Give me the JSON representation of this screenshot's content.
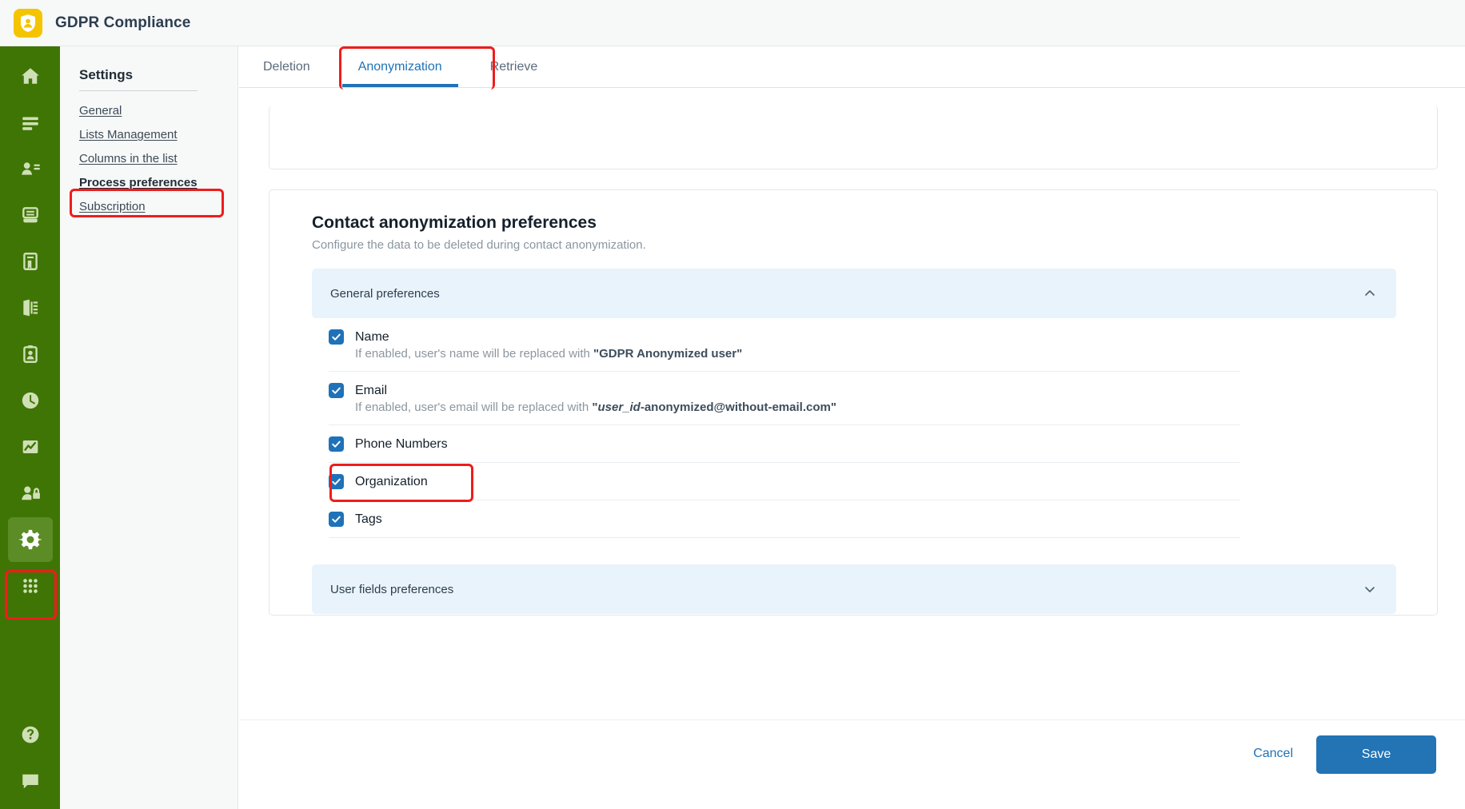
{
  "app": {
    "title": "GDPR Compliance",
    "logo_icon": "shield-user-icon"
  },
  "rail": {
    "items": [
      {
        "name": "home",
        "icon": "home-icon",
        "active": false
      },
      {
        "name": "lists",
        "icon": "menu-lines-icon",
        "active": false
      },
      {
        "name": "contacts",
        "icon": "contact-list-icon",
        "active": false
      },
      {
        "name": "database",
        "icon": "database-icon",
        "active": false
      },
      {
        "name": "documents",
        "icon": "document-icon",
        "active": false
      },
      {
        "name": "export",
        "icon": "export-door-icon",
        "active": false
      },
      {
        "name": "requests",
        "icon": "clipboard-user-icon",
        "active": false
      },
      {
        "name": "history",
        "icon": "clock-icon",
        "active": false
      },
      {
        "name": "reports",
        "icon": "chart-image-icon",
        "active": false
      },
      {
        "name": "privacy",
        "icon": "user-lock-icon",
        "active": false
      },
      {
        "name": "settings",
        "icon": "gear-icon",
        "active": true
      },
      {
        "name": "apps",
        "icon": "grid-dots-icon",
        "active": false
      },
      {
        "name": "help",
        "icon": "question-circle-icon",
        "active": false
      },
      {
        "name": "feedback",
        "icon": "chat-icon",
        "active": false
      }
    ]
  },
  "settings": {
    "heading": "Settings",
    "links": [
      {
        "label": "General",
        "selected": false
      },
      {
        "label": "Lists Management",
        "selected": false
      },
      {
        "label": "Columns in the list",
        "selected": false
      },
      {
        "label": "Process preferences",
        "selected": true
      },
      {
        "label": "Subscription",
        "selected": false
      }
    ]
  },
  "tabs": [
    {
      "label": "Deletion",
      "active": false
    },
    {
      "label": "Anonymization",
      "active": true
    },
    {
      "label": "Retrieve",
      "active": false
    }
  ],
  "card": {
    "title": "Contact anonymization preferences",
    "subtitle": "Configure the data to be deleted during contact anonymization.",
    "general_section": {
      "label": "General preferences",
      "expanded": true,
      "chevron_icon": "chevron-up-icon",
      "options": [
        {
          "label": "Name",
          "checked": true,
          "desc_prefix": "If enabled, user's name will be replaced with ",
          "desc_strong": "\"GDPR Anonymized user\"",
          "desc_strong_italic": ""
        },
        {
          "label": "Email",
          "checked": true,
          "desc_prefix": "If enabled, user's email will be replaced with ",
          "desc_strong_italic": "user_id",
          "desc_strong": "-anonymized@without-email.com\"",
          "desc_quote_open": "\""
        },
        {
          "label": "Phone Numbers",
          "checked": true,
          "desc_prefix": "",
          "desc_strong": ""
        },
        {
          "label": "Organization",
          "checked": true,
          "desc_prefix": "",
          "desc_strong": ""
        },
        {
          "label": "Tags",
          "checked": true,
          "desc_prefix": "",
          "desc_strong": ""
        }
      ]
    },
    "user_fields_section": {
      "label": "User fields preferences",
      "expanded": false,
      "chevron_icon": "chevron-down-icon"
    }
  },
  "footer": {
    "cancel_label": "Cancel",
    "save_label": "Save"
  },
  "colors": {
    "rail_green": "#3f7505",
    "accent_blue": "#1f72b8",
    "save_blue": "#2274b5",
    "accordion_bg": "#e9f3fb",
    "annotation_red": "#ef1c1c",
    "logo_yellow": "#f5c400"
  }
}
